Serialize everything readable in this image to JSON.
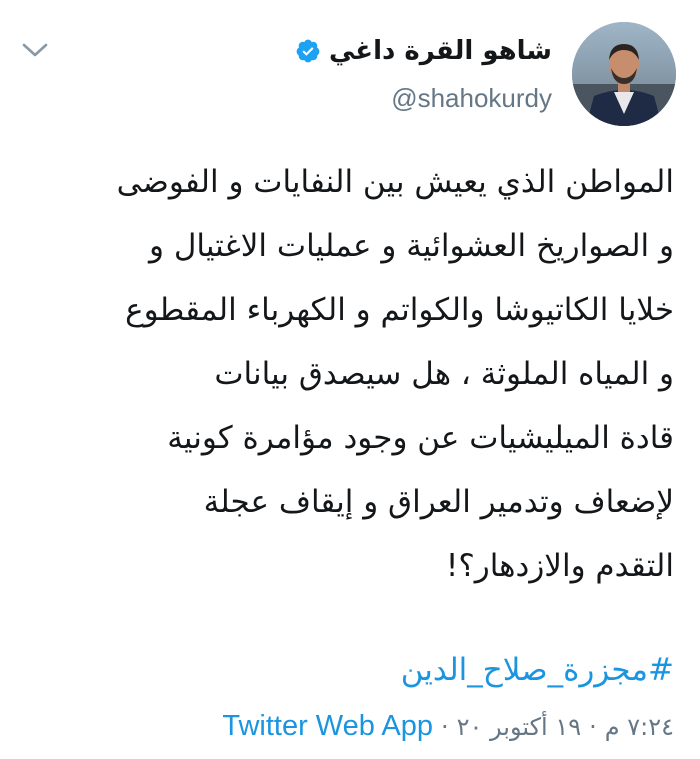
{
  "author": {
    "name": "شاهو القرة داغي",
    "handle": "@shahokurdy",
    "verified": true
  },
  "tweet": {
    "lines": [
      "المواطن الذي يعيش بين النفايات و الفوضى",
      "و الصواريخ العشوائية و عمليات الاغتيال و",
      "خلايا الكاتيوشا والكواتم و الكهرباء المقطوع",
      "و المياه الملوثة ، هل سيصدق بيانات",
      "قادة الميليشيات عن وجود مؤامرة كونية",
      "لإضعاف وتدمير العراق و إيقاف عجلة",
      "التقدم والازدهار؟!"
    ],
    "hashtag": "#مجزرة_صلاح_الدين"
  },
  "meta": {
    "time": "٧:٢٤ م",
    "separator": "·",
    "date": "١٩ أكتوبر ٢٠",
    "source": "Twitter Web App"
  },
  "colors": {
    "accent": "#1b95e0",
    "secondary_text": "#657786",
    "primary_text": "#14171a",
    "verified_badge": "#1da1f2"
  },
  "icons": {
    "menu": "chevron-down-icon",
    "verified": "verified-badge-icon"
  }
}
